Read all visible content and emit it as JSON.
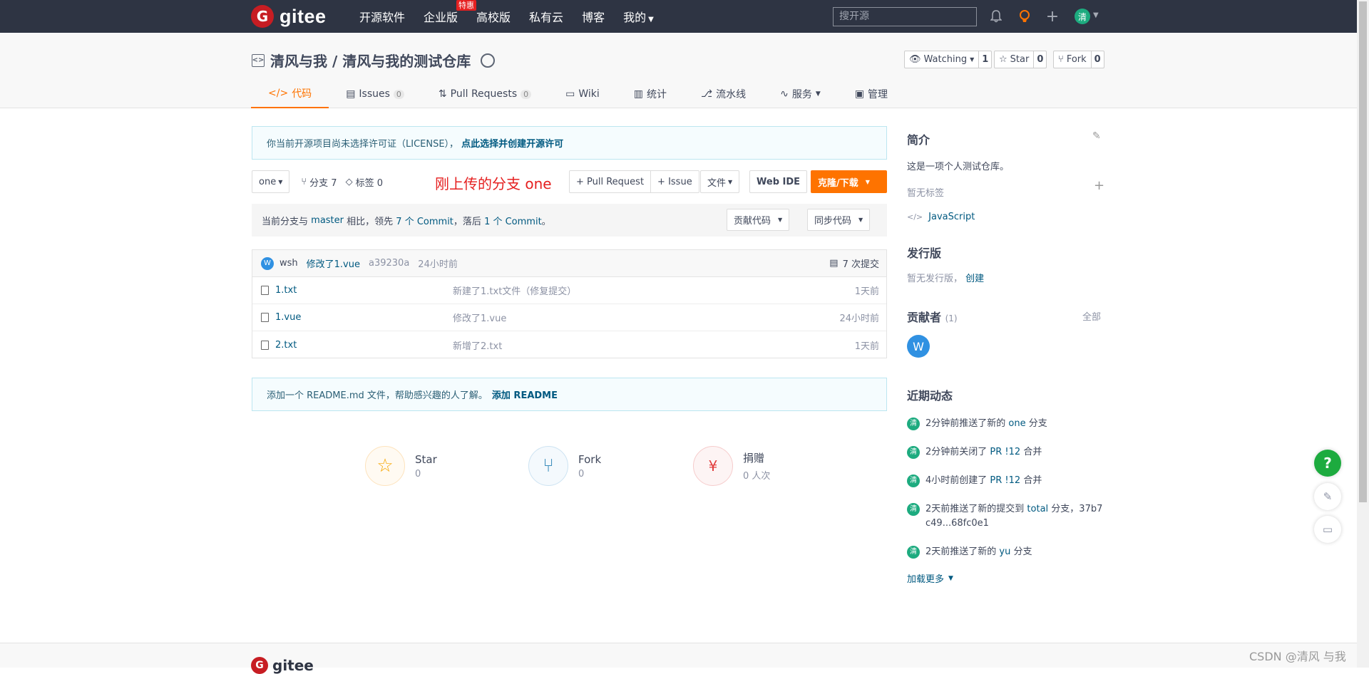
{
  "topbar": {
    "logo": "gitee",
    "nav": [
      "开源软件",
      "企业版",
      "高校版",
      "私有云",
      "博客",
      "我的"
    ],
    "hot_badge": "特惠",
    "search_placeholder": "搜开源",
    "avatar": "清"
  },
  "project": {
    "title": "清风与我 / 清风与我的测试仓库",
    "watch_label": "Watching",
    "watch_count": "1",
    "star_label": "Star",
    "star_count": "0",
    "fork_label": "Fork",
    "fork_count": "0"
  },
  "tabs": [
    {
      "label": "代码",
      "count": ""
    },
    {
      "label": "Issues",
      "count": "0"
    },
    {
      "label": "Pull Requests",
      "count": "0"
    },
    {
      "label": "Wiki",
      "count": ""
    },
    {
      "label": "统计",
      "count": ""
    },
    {
      "label": "流水线",
      "count": ""
    },
    {
      "label": "服务",
      "count": ""
    },
    {
      "label": "管理",
      "count": ""
    }
  ],
  "license_notice": {
    "text": "你当前开源项目尚未选择许可证（LICENSE），",
    "link": "点此选择并创建开源许可"
  },
  "toolbar": {
    "branch": "one",
    "branches": "分支 7",
    "tags": "标签 0",
    "annotation": "刚上传的分支 one",
    "pull_request": "+ Pull Request",
    "issue": "+ Issue",
    "file": "文件",
    "web_ide": "Web IDE",
    "clone": "克隆/下载"
  },
  "compare": {
    "prefix": "当前分支与",
    "base": "master",
    "mid": "相比，领先",
    "ahead": "7 个 Commit",
    "mid2": "，落后",
    "behind": "1 个 Commit",
    "suffix": "。",
    "contribute": "贡献代码",
    "sync": "同步代码"
  },
  "latest_commit": {
    "avatar": "W",
    "author": "wsh",
    "message": "修改了1.vue",
    "hash": "a39230a",
    "time": "24小时前",
    "count": "7 次提交"
  },
  "files": [
    {
      "name": "1.txt",
      "message": "新建了1.txt文件（修复提交）",
      "time": "1天前"
    },
    {
      "name": "1.vue",
      "message": "修改了1.vue",
      "time": "24小时前"
    },
    {
      "name": "2.txt",
      "message": "新增了2.txt",
      "time": "1天前"
    }
  ],
  "readme_notice": {
    "text": "添加一个 README.md 文件，帮助感兴趣的人了解。",
    "link": "添加 README"
  },
  "stats": [
    {
      "label": "Star",
      "value": "0"
    },
    {
      "label": "Fork",
      "value": "0"
    },
    {
      "label": "捐赠",
      "value": "0 人次"
    }
  ],
  "sidebar": {
    "intro_title": "简介",
    "intro_text": "这是一项个人测试仓库。",
    "no_tags": "暂无标签",
    "language": "JavaScript",
    "release_title": "发行版",
    "release_text": "暂无发行版，",
    "release_link": "创建",
    "contrib_title": "贡献者",
    "contrib_count": "(1)",
    "contrib_all": "全部",
    "contrib_avatar": "W",
    "activity_title": "近期动态",
    "load_more": "加载更多"
  },
  "activities": [
    {
      "pre": "2分钟前推送了新的",
      "link": "one",
      "post": "分支"
    },
    {
      "pre": "2分钟前关闭了",
      "link": "PR !12",
      "post": "合并"
    },
    {
      "pre": "4小时前创建了",
      "link": "PR !12",
      "post": "合并"
    },
    {
      "pre": "2天前推送了新的提交到",
      "link": "total",
      "post": "分支，37b7c49...68fc0e1"
    },
    {
      "pre": "2天前推送了新的",
      "link": "yu",
      "post": "分支"
    }
  ],
  "footer": {
    "logo": "gitee",
    "watermark": "CSDN @清风 与我"
  },
  "colors": {
    "accent": "#fe7300",
    "topbar": "#2e3443",
    "link": "#005980",
    "avatar": "#1dab7f"
  }
}
